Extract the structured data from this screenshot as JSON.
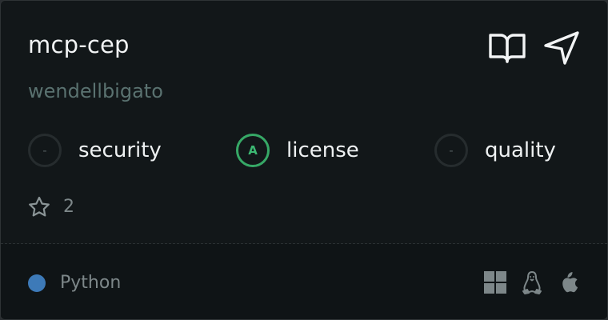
{
  "repo": {
    "name": "mcp-cep",
    "owner": "wendellbigato"
  },
  "actions": [
    {
      "icon": "book-icon",
      "label": "Documentation"
    },
    {
      "icon": "send-icon",
      "label": "Share"
    }
  ],
  "scores": [
    {
      "label": "security",
      "grade": "-"
    },
    {
      "label": "license",
      "grade": "A"
    },
    {
      "label": "quality",
      "grade": "-"
    }
  ],
  "stars": {
    "icon": "star-icon",
    "count": "2"
  },
  "footer": {
    "language": {
      "name": "Python",
      "color": "#3d7ab8"
    },
    "platforms": [
      "windows-icon",
      "linux-icon",
      "apple-icon"
    ]
  },
  "colors": {
    "background": "#121719",
    "grade_a": "#36a866",
    "muted_text": "#7d8789",
    "owner_text": "#5a7270"
  }
}
